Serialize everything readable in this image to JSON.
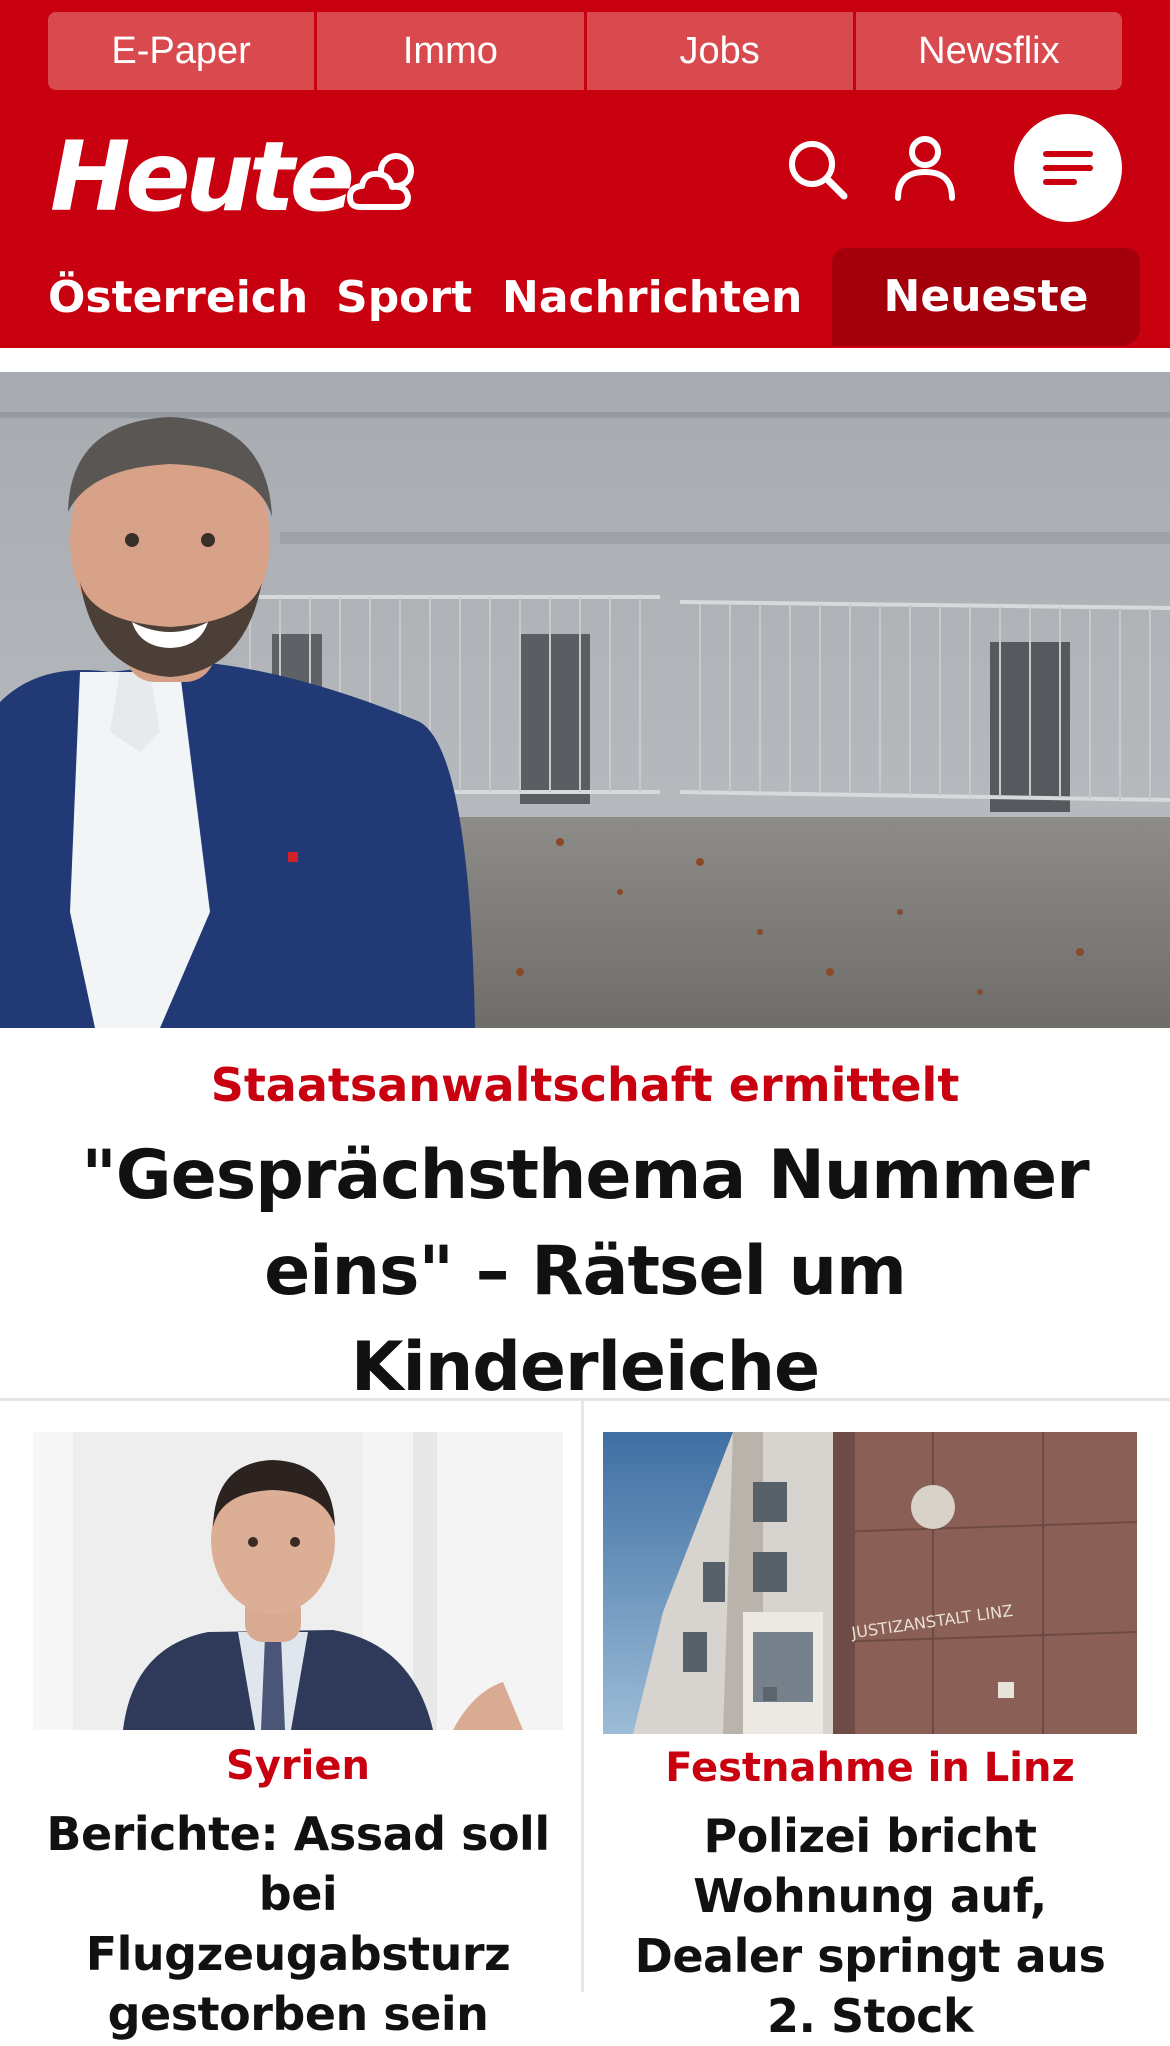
{
  "quicklinks": [
    {
      "label": "E-Paper"
    },
    {
      "label": "Immo"
    },
    {
      "label": "Jobs"
    },
    {
      "label": "Newsflix"
    }
  ],
  "header": {
    "logo_text": "Heute",
    "icons": [
      "weather-cloud-icon",
      "search-icon",
      "user-icon",
      "menu-icon"
    ]
  },
  "nav": {
    "items": [
      {
        "label": "Österreich"
      },
      {
        "label": "Sport"
      },
      {
        "label": "Nachrichten"
      },
      {
        "label": "Neueste",
        "active": true
      }
    ]
  },
  "hero": {
    "kicker": "Staatsanwaltschaft ermittelt",
    "title": "\"Gesprächsthema Nummer eins\" – Rätsel um Kinderleiche"
  },
  "teasers": [
    {
      "kicker": "Syrien",
      "title": "Berichte: Assad soll bei Flugzeugabsturz gestorben sein"
    },
    {
      "kicker": "Festnahme in Linz",
      "title": "Polizei bricht Wohnung auf, Dealer springt aus 2. Stock",
      "image_sign": "JUSTIZANSTALT LINZ"
    }
  ],
  "colors": {
    "brand_red": "#c8000f",
    "nav_active_red": "#a3000b",
    "quicklink_bg": "#d94a4f",
    "kicker_red": "#c8000f"
  }
}
